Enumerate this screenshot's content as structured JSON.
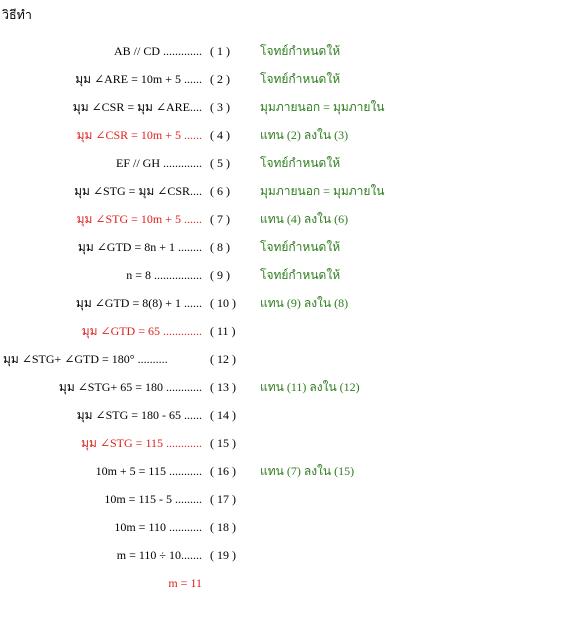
{
  "title": "วิธีทำ",
  "steps": [
    {
      "expr": "AB // CD .............",
      "num": "( 1 )",
      "reason": "โจทย์กำหนดให้"
    },
    {
      "expr": "มุม ∠ARE = 10m + 5 ......",
      "num": "( 2 )",
      "reason": "โจทย์กำหนดให้"
    },
    {
      "expr": "มุม ∠CSR = มุม ∠ARE....",
      "num": "( 3 )",
      "reason": "มุมภายนอก = มุมภายใน"
    },
    {
      "expr": "มุม ∠CSR = 10m + 5 ......",
      "num": "( 4 )",
      "reason": "แทน (2) ลงใน (3)"
    },
    {
      "expr": "EF // GH .............",
      "num": "( 5 )",
      "reason": "โจทย์กำหนดให้"
    },
    {
      "expr": "มุม ∠STG = มุม ∠CSR....",
      "num": "( 6 )",
      "reason": "มุมภายนอก = มุมภายใน"
    },
    {
      "expr": "มุม ∠STG = 10m + 5 ......",
      "num": "( 7 )",
      "reason": "แทน (4) ลงใน (6)"
    },
    {
      "expr": "มุม ∠GTD = 8n + 1 ........",
      "num": "( 8 )",
      "reason": "โจทย์กำหนดให้"
    },
    {
      "expr": "n = 8 ................",
      "num": "( 9 )",
      "reason": "โจทย์กำหนดให้"
    },
    {
      "expr": "มุม ∠GTD = 8(8) + 1 ......",
      "num": "( 10 )",
      "reason": "แทน (9) ลงใน (8)"
    },
    {
      "expr": "มุม ∠GTD = 65 .............",
      "num": "( 11 )",
      "reason": ""
    },
    {
      "expr": "มุม ∠STG+       ∠GTD = 180° ..........",
      "num": "( 12 )",
      "reason": ""
    },
    {
      "expr": "มุม ∠STG+ 65 = 180 ............",
      "num": "( 13 )",
      "reason": "แทน (11) ลงใน (12)"
    },
    {
      "expr": "มุม ∠STG = 180 - 65 ......",
      "num": "( 14 )",
      "reason": ""
    },
    {
      "expr": "มุม ∠STG = 115 ............",
      "num": "( 15 )",
      "reason": ""
    },
    {
      "expr": "10m + 5 = 115 ...........",
      "num": "( 16 )",
      "reason": "แทน (7) ลงใน (15)"
    },
    {
      "expr": "10m = 115 - 5 .........",
      "num": "( 17 )",
      "reason": ""
    },
    {
      "expr": "10m = 110 ...........",
      "num": "( 18 )",
      "reason": ""
    },
    {
      "expr": "m = 110 ÷ 10.......",
      "num": "( 19 )",
      "reason": ""
    },
    {
      "expr": "m = 11",
      "num": "",
      "reason": ""
    }
  ]
}
